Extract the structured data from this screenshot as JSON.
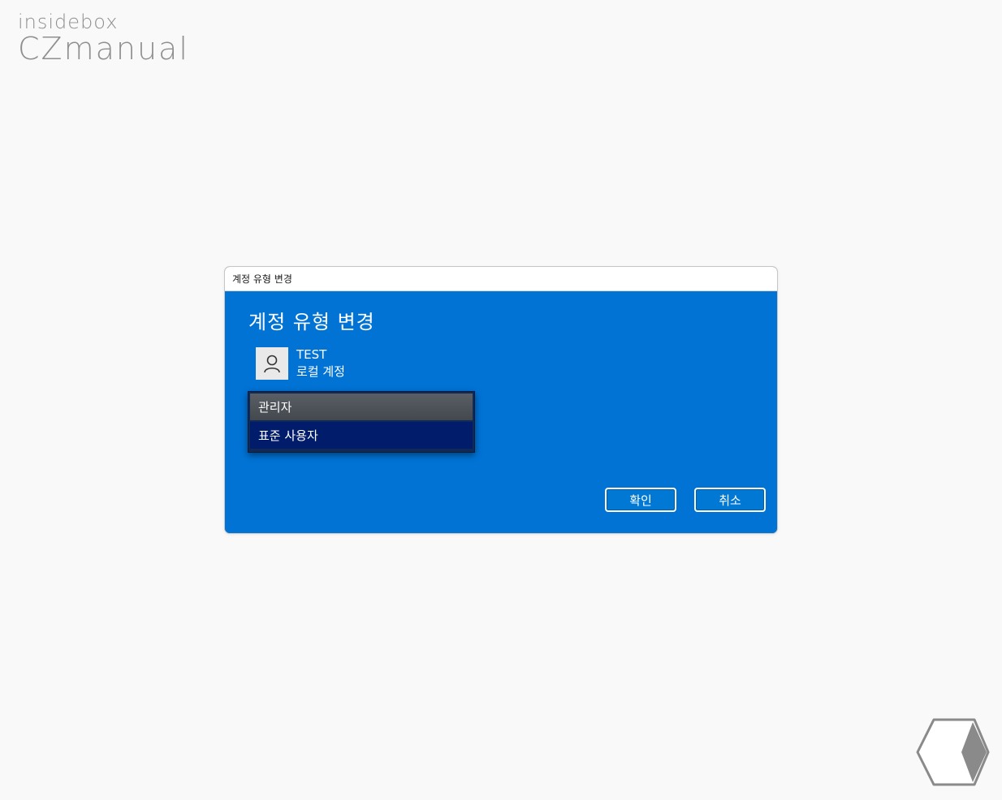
{
  "brand": {
    "top": "insidebox",
    "main": "CZmanual"
  },
  "dialog": {
    "window_title": "계정 유형 변경",
    "heading": "계정 유형 변경",
    "account": {
      "name": "TEST",
      "type": "로컬 계정"
    },
    "dropdown": {
      "options": [
        "관리자",
        "표준 사용자"
      ]
    },
    "buttons": {
      "ok": "확인",
      "cancel": "취소"
    }
  },
  "colors": {
    "accent": "#0078d4",
    "highlight": "#001c6b",
    "hover": "#4a4f56"
  }
}
